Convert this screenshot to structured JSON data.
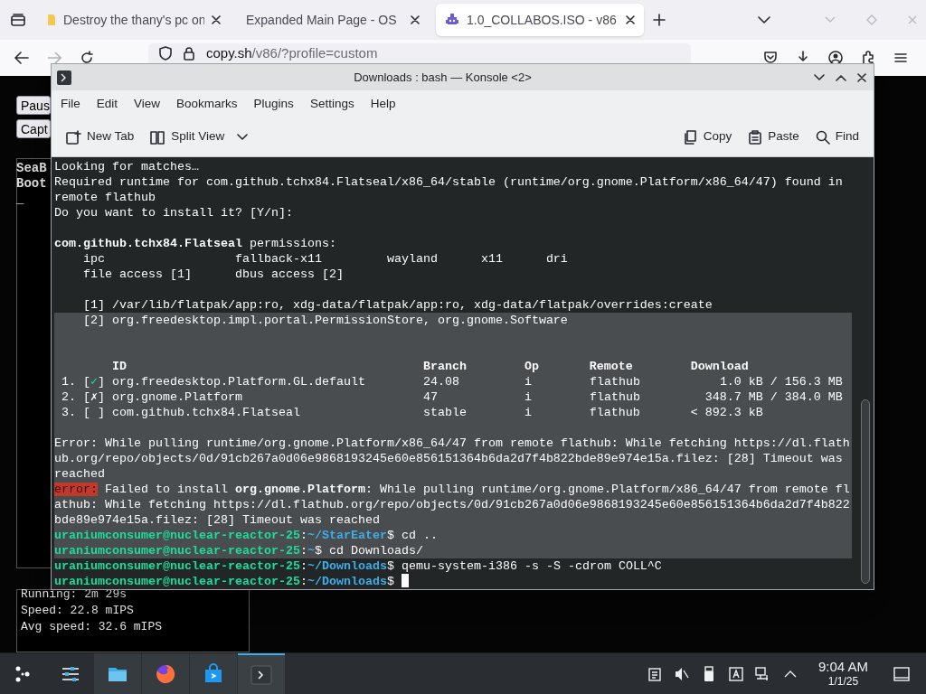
{
  "browser": {
    "tabs": [
      {
        "title": "Destroy the thany's pc on",
        "kind": "note",
        "selected": false
      },
      {
        "title": "Expanded Main Page - OS",
        "kind": "none",
        "selected": false
      },
      {
        "title": "1.0_COLLABOS.ISO - v86",
        "kind": "bot",
        "selected": true
      }
    ],
    "url_host": "copy.sh",
    "url_path": "/v86/?profile=custom"
  },
  "page": {
    "buttons": [
      "Paus",
      "Capt"
    ],
    "screen_lines": [
      "SeaB",
      "Boot",
      "_"
    ],
    "stats": [
      "Running: 2m 29s",
      "Speed: 22.8 mIPS",
      "Avg speed: 32.6 mIPS"
    ]
  },
  "konsole": {
    "title": "Downloads : bash — Konsole <2>",
    "menu": [
      "File",
      "Edit",
      "View",
      "Bookmarks",
      "Plugins",
      "Settings",
      "Help"
    ],
    "toolbar_left": [
      "New Tab",
      "Split View"
    ],
    "toolbar_right": [
      "Copy",
      "Paste",
      "Find"
    ],
    "cursor_visible": true,
    "lines": [
      {
        "selected": false,
        "spans": [
          {
            "kind": "plain",
            "text": "Looking for matches…"
          }
        ]
      },
      {
        "selected": false,
        "spans": [
          {
            "kind": "plain",
            "text": "Required runtime for com.github.tchx84.Flatseal/x86_64/stable (runtime/org.gnome.Platform/x86_64/47) found in"
          }
        ]
      },
      {
        "selected": false,
        "spans": [
          {
            "kind": "plain",
            "text": "remote flathub"
          }
        ]
      },
      {
        "selected": false,
        "spans": [
          {
            "kind": "plain",
            "text": "Do you want to install it? [Y/n]:"
          }
        ]
      },
      {
        "selected": false
      },
      {
        "selected": false,
        "spans": [
          {
            "kind": "bold",
            "text": "com.github.tchx84.Flatseal"
          },
          {
            "kind": "plain",
            "text": " permissions:"
          }
        ]
      },
      {
        "selected": false,
        "spans": [
          {
            "kind": "plain",
            "text": "    ipc                  fallback-x11         wayland      x11      dri"
          }
        ]
      },
      {
        "selected": false,
        "spans": [
          {
            "kind": "plain",
            "text": "    file access [1]      dbus access [2]"
          }
        ]
      },
      {
        "selected": false
      },
      {
        "selected": false,
        "spans": [
          {
            "kind": "plain",
            "text": "    [1] /var/lib/flatpak/app:ro, xdg-data/flatpak/app:ro, xdg-data/flatpak/overrides:create"
          }
        ]
      },
      {
        "selected": true,
        "spans": [
          {
            "kind": "plain",
            "text": "    [2] org.freedesktop.impl.portal.PermissionStore, org.gnome.Software"
          }
        ]
      },
      {
        "selected": true
      },
      {
        "selected": true
      },
      {
        "selected": true,
        "spans": [
          {
            "kind": "bold",
            "text": "        ID                                         Branch        Op       Remote        Download"
          }
        ]
      },
      {
        "selected": true,
        "spans": [
          {
            "kind": "plain",
            "text": " 1. ["
          },
          {
            "kind": "ok",
            "text": "✓"
          },
          {
            "kind": "plain",
            "text": "] org.freedesktop.Platform.GL.default        24.08         i        flathub           1.0 kB / 156.3 MB"
          }
        ]
      },
      {
        "selected": true,
        "spans": [
          {
            "kind": "plain",
            "text": " 2. [✗] org.gnome.Platform                         47            i        flathub         348.7 MB / 384.0 MB"
          }
        ]
      },
      {
        "selected": true,
        "spans": [
          {
            "kind": "plain",
            "text": " 3. [ ] com.github.tchx84.Flatseal                 stable        i        flathub       < 892.3 kB"
          }
        ]
      },
      {
        "selected": true
      },
      {
        "selected": true,
        "spans": [
          {
            "kind": "plain",
            "text": "Error: While pulling runtime/org.gnome.Platform/x86_64/47 from remote flathub: While fetching https://dl.flath"
          }
        ]
      },
      {
        "selected": true,
        "spans": [
          {
            "kind": "plain",
            "text": "ub.org/repo/objects/0d/91cb267a0d06e9868193245e60e856151364b6da2d7f4b822bde89e974e15a.filez: [28] Timeout was"
          }
        ]
      },
      {
        "selected": true,
        "spans": [
          {
            "kind": "plain",
            "text": "reached"
          }
        ]
      },
      {
        "selected": true,
        "spans": [
          {
            "kind": "error",
            "text": "error:"
          },
          {
            "kind": "plain",
            "text": " Failed to install "
          },
          {
            "kind": "bold",
            "text": "org.gnome.Platform"
          },
          {
            "kind": "plain",
            "text": ": While pulling runtime/org.gnome.Platform/x86_64/47 from remote fl"
          }
        ]
      },
      {
        "selected": true,
        "spans": [
          {
            "kind": "plain",
            "text": "athub: While fetching https://dl.flathub.org/repo/objects/0d/91cb267a0d06e9868193245e60e856151364b6da2d7f4b822"
          }
        ]
      },
      {
        "selected": true,
        "spans": [
          {
            "kind": "plain",
            "text": "bde89e974e15a.filez: [28] Timeout was reached"
          }
        ]
      },
      {
        "selected": true,
        "spans": [
          {
            "kind": "user",
            "text": "uraniumconsumer@nuclear-reactor-25"
          },
          {
            "kind": "plain",
            "text": ":"
          },
          {
            "kind": "path",
            "text": "~/StarEater"
          },
          {
            "kind": "plain",
            "text": "$ cd .."
          }
        ]
      },
      {
        "selected": true,
        "spans": [
          {
            "kind": "user",
            "text": "uraniumconsumer@nuclear-reactor-25"
          },
          {
            "kind": "plain",
            "text": ":"
          },
          {
            "kind": "path",
            "text": "~"
          },
          {
            "kind": "plain",
            "text": "$ cd Downloads/"
          }
        ]
      },
      {
        "selected": false,
        "spans": [
          {
            "kind": "user",
            "text": "uraniumconsumer@nuclear-reactor-25"
          },
          {
            "kind": "plain",
            "text": ":"
          },
          {
            "kind": "path",
            "text": "~/Downloads"
          },
          {
            "kind": "plain",
            "text": "$ qemu-system-i386 -s -S -cdrom COLL^C"
          }
        ]
      },
      {
        "selected": false,
        "spans": [
          {
            "kind": "user",
            "text": "uraniumconsumer@nuclear-reactor-25"
          },
          {
            "kind": "plain",
            "text": ":"
          },
          {
            "kind": "path",
            "text": "~/Downloads"
          },
          {
            "kind": "plain",
            "text": "$"
          }
        ]
      }
    ]
  },
  "taskbar": {
    "apps": [
      {
        "kind": "launcher",
        "active": false
      },
      {
        "kind": "mixer",
        "active": false
      },
      {
        "kind": "folder",
        "active": false
      },
      {
        "kind": "browser",
        "active": false
      },
      {
        "kind": "store",
        "active": false
      },
      {
        "kind": "terminal",
        "active": true
      }
    ],
    "time": "9:04 AM",
    "date": "1/1/25"
  }
}
